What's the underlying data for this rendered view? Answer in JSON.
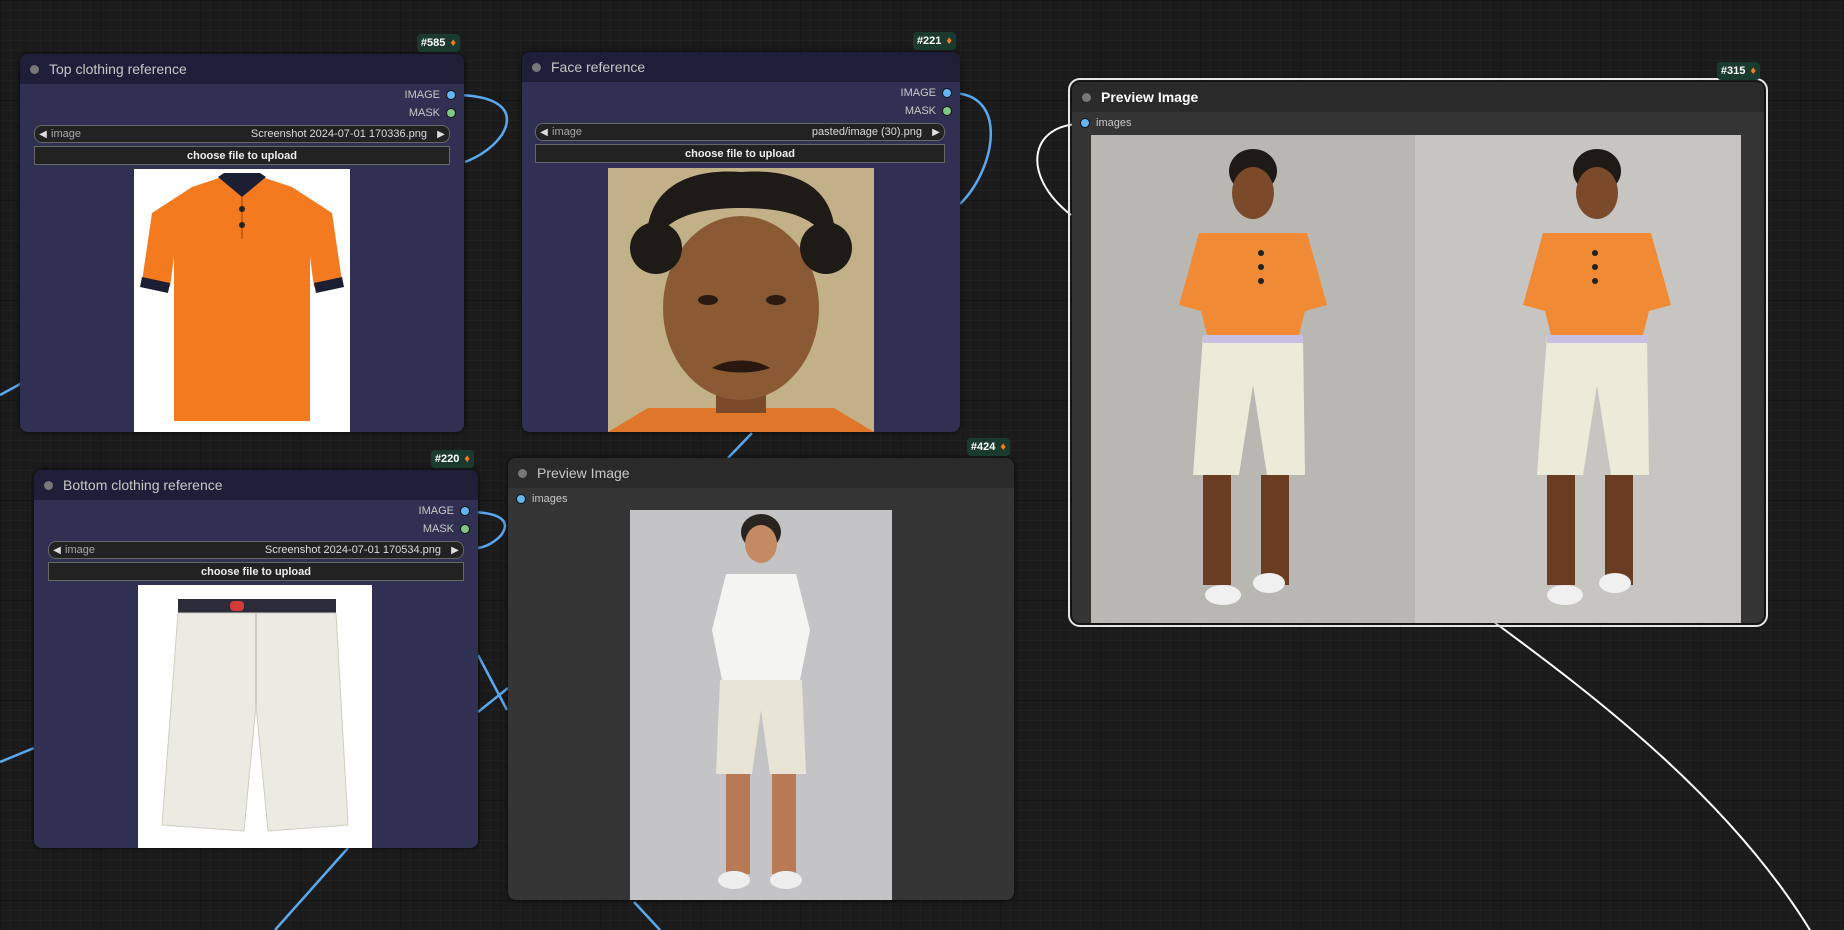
{
  "nodes": {
    "top_clothing": {
      "id": "#585",
      "title": "Top clothing reference",
      "outputs": [
        "IMAGE",
        "MASK"
      ],
      "widget_label": "image",
      "widget_value": "Screenshot 2024-07-01 170336.png",
      "upload_label": "choose file to upload"
    },
    "face": {
      "id": "#221",
      "title": "Face reference",
      "outputs": [
        "IMAGE",
        "MASK"
      ],
      "widget_label": "image",
      "widget_value": "pasted/image (30).png",
      "upload_label": "choose file to upload"
    },
    "bottom_clothing": {
      "id": "#220",
      "title": "Bottom clothing reference",
      "outputs": [
        "IMAGE",
        "MASK"
      ],
      "widget_label": "image",
      "widget_value": "Screenshot 2024-07-01 170534.png",
      "upload_label": "choose file to upload"
    },
    "preview_small": {
      "id": "#424",
      "title": "Preview Image",
      "input": "images"
    },
    "preview_large": {
      "id": "#315",
      "title": "Preview Image",
      "input": "images"
    }
  },
  "icons": {
    "badge_icon": "fox-icon",
    "arrow_left": "◀",
    "arrow_right": "▶"
  },
  "colors": {
    "canvas": "#1b1b1b",
    "node_blue": "#303052",
    "node_gray": "#353535",
    "image_socket": "#64b5f6",
    "mask_socket": "#81c784",
    "wire": "#64b5f6",
    "badge_bg": "#1a3a2e"
  }
}
